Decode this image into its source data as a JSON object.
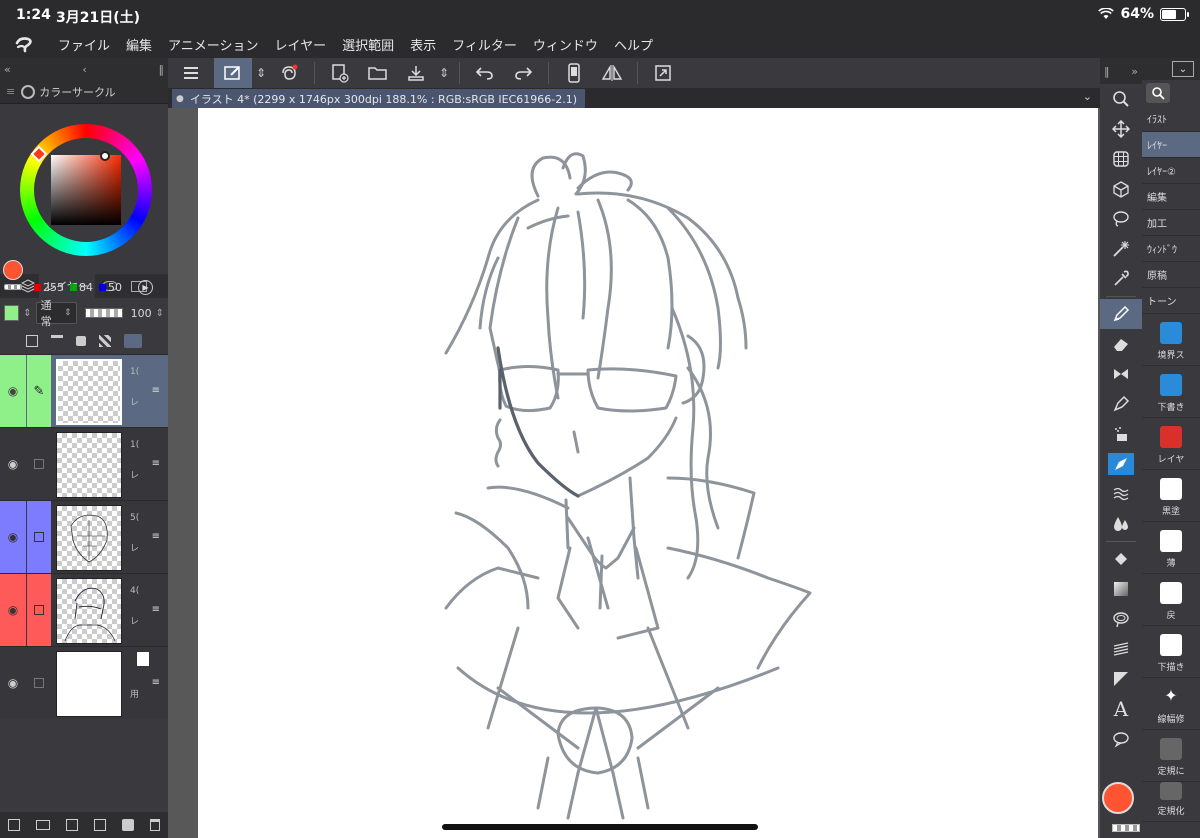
{
  "status": {
    "time": "1:24",
    "date": "3月21日(土)",
    "battery": "64%"
  },
  "menu": [
    "ファイル",
    "編集",
    "アニメーション",
    "レイヤー",
    "選択範囲",
    "表示",
    "フィルター",
    "ウィンドウ",
    "ヘルプ"
  ],
  "color_panel": {
    "title": "カラーサークル",
    "r": "255",
    "g": "84",
    "b": "50",
    "current_color": "#ff5432"
  },
  "layer_panel": {
    "tab": "レイヤー",
    "blend_mode": "通常",
    "opacity": "100",
    "layers": [
      {
        "label_color": "#8ff08a",
        "info": "1(",
        "mode": "レ",
        "selected": true
      },
      {
        "label_color": "",
        "info": "1(",
        "mode": "レ",
        "selected": false
      },
      {
        "label_color": "#7d7cff",
        "info": "5(",
        "mode": "レ",
        "selected": false
      },
      {
        "label_color": "#ff5a5a",
        "info": "4(",
        "mode": "レ",
        "selected": false
      },
      {
        "label_color": "",
        "info": "",
        "mode": "用",
        "selected": false
      }
    ]
  },
  "document": {
    "tab_title": "イラスト 4* (2299 x 1746px 300dpi 188.1% : RGB:sRGB IEC61966-2.1)"
  },
  "tools": [
    "zoom-icon",
    "move-icon",
    "grid-icon",
    "3d-icon",
    "lasso-icon",
    "magic-wand-icon",
    "eyedropper-icon",
    "pen-icon",
    "eraser-icon",
    "ribbon-icon",
    "pen-nib-icon",
    "airbrush-icon",
    "decoration-icon",
    "blend-icon",
    "water-icon",
    "fill-icon",
    "gradient-icon",
    "figure-icon",
    "ruler-icon",
    "frame-icon",
    "text-icon",
    "balloon-icon"
  ],
  "sub_tool_tabs": [
    "ｲﾗｽﾄ",
    "ﾚｲﾔｰ",
    "ﾚｲﾔｰ②",
    "編集",
    "加工",
    "ｳｨﾝﾄﾞｳ",
    "原稿",
    "トーン"
  ],
  "sub_tool_items": [
    {
      "label": "境界ス",
      "color": "#2a8cd9"
    },
    {
      "label": "下書き",
      "color": "#2a8cd9"
    },
    {
      "label": "レイヤ",
      "color": "#d9302a"
    },
    {
      "label": "黒塗",
      "color": "#ffffff"
    },
    {
      "label": "薄",
      "color": "#ffffff"
    },
    {
      "label": "戻",
      "color": "#ffffff"
    },
    {
      "label": "下描き",
      "color": "#ffffff"
    },
    {
      "label": "線幅修",
      "color": "#ffffff"
    },
    {
      "label": "定規に",
      "color": "#777777"
    },
    {
      "label": "定規化",
      "color": "#777777"
    }
  ]
}
